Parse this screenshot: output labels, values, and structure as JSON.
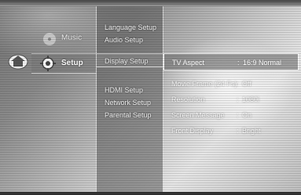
{
  "main_menu": {
    "items": [
      {
        "label": "Music",
        "icon": "music-disc-icon"
      },
      {
        "label": "Setup",
        "icon": "gear-icon",
        "active": true
      }
    ],
    "home_icon": "home-icon"
  },
  "setup_menu": {
    "items": [
      {
        "label": "Language Setup"
      },
      {
        "label": "Audio Setup"
      },
      {
        "label": "Display Setup",
        "active": true
      },
      {
        "label": "HDMI Setup"
      },
      {
        "label": "Network Setup"
      },
      {
        "label": "Parental Setup"
      }
    ]
  },
  "display_options": {
    "rows": [
      {
        "name": "TV Aspect",
        "value": "16:9 Normal",
        "selected": true
      },
      {
        "name": "Movie Frame (24 Fs)",
        "value": "Off"
      },
      {
        "name": "Resolution",
        "value": "1080i"
      },
      {
        "name": "Screen Message",
        "value": "On"
      },
      {
        "name": "Front Display",
        "value": "Bright"
      }
    ],
    "colon": ":"
  }
}
